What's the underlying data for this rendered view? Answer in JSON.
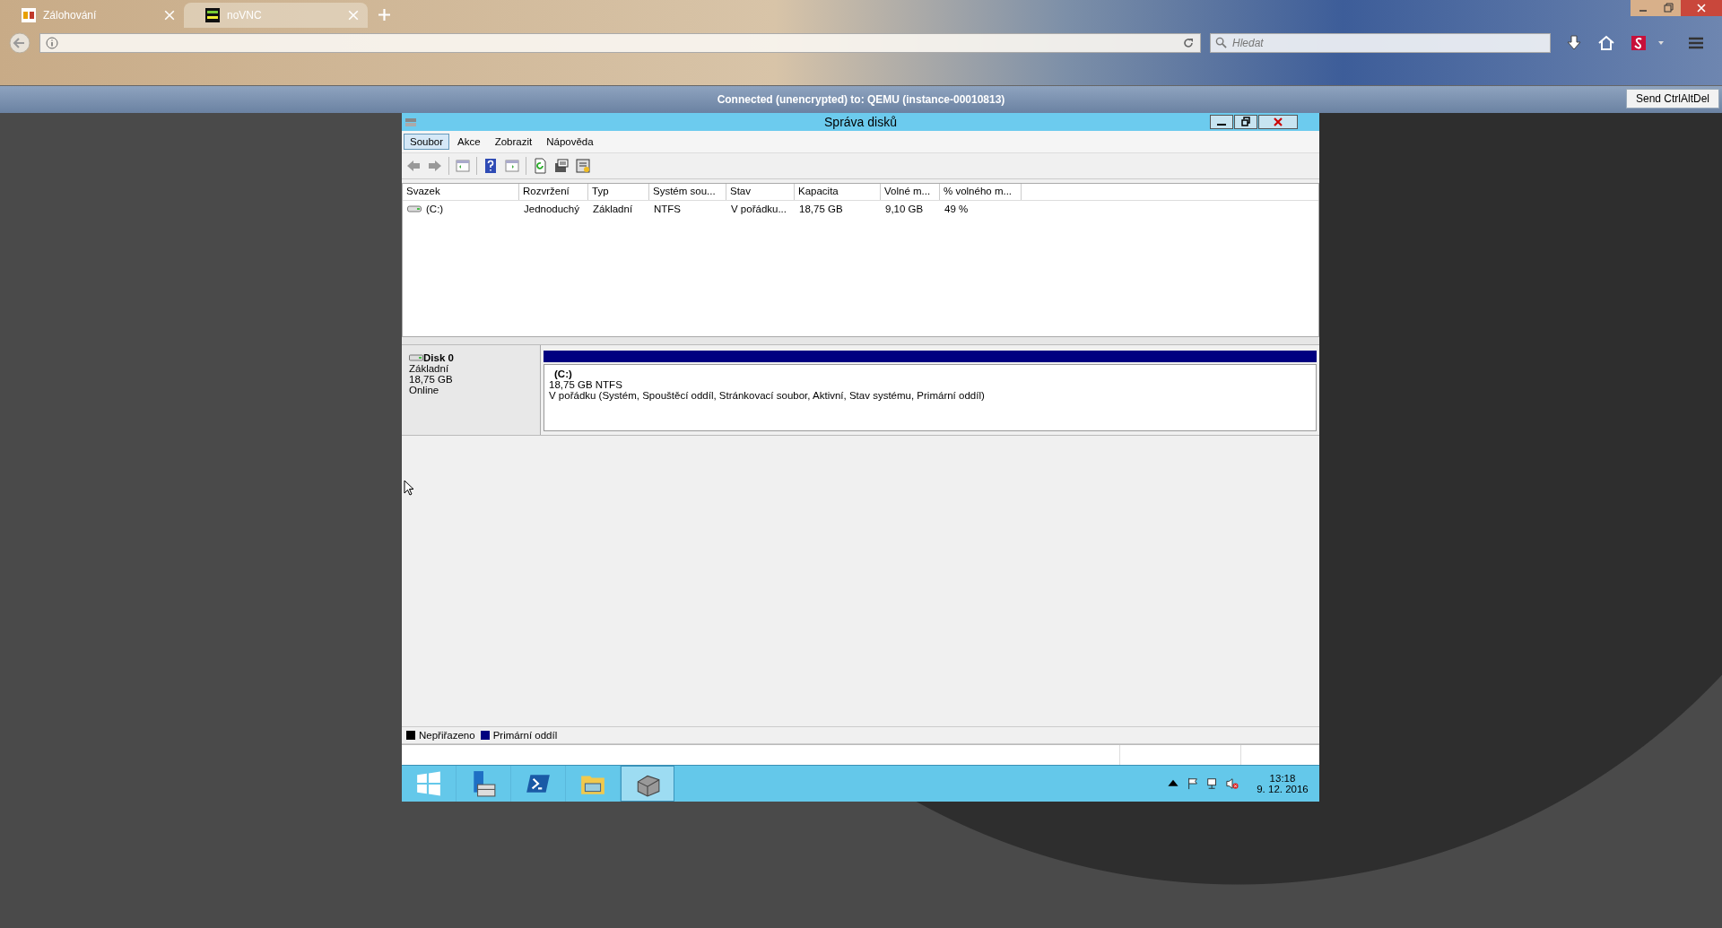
{
  "browser": {
    "tabs": [
      {
        "title": "Zálohování",
        "selected": false,
        "kind": "hc"
      },
      {
        "title": "noVNC",
        "selected": true,
        "kind": "vnc"
      }
    ],
    "search": {
      "placeholder": "Hledat"
    }
  },
  "vnc": {
    "status": "Connected (unencrypted) to: QEMU (instance-00010813)",
    "button": "Send CtrlAltDel"
  },
  "window": {
    "title": "Správa disků"
  },
  "menu": [
    {
      "label": "Soubor",
      "selected": true
    },
    {
      "label": "Akce",
      "selected": false
    },
    {
      "label": "Zobrazit",
      "selected": false
    },
    {
      "label": "Nápověda",
      "selected": false
    }
  ],
  "table": {
    "columns": [
      "Svazek",
      "Rozvržení",
      "Typ",
      "Systém sou...",
      "Stav",
      "Kapacita",
      "Volné m...",
      "% volného m..."
    ],
    "rows": [
      [
        "(C:)",
        "Jednoduchý",
        "Základní",
        "NTFS",
        "V pořádku...",
        "18,75 GB",
        "9,10 GB",
        "49 %"
      ]
    ]
  },
  "disk": {
    "name": "Disk 0",
    "type": "Základní",
    "size": "18,75 GB",
    "status": "Online",
    "partition": {
      "label": "(C:)",
      "size_fs": "18,75 GB NTFS",
      "status": "V pořádku (Systém, Spouštěcí oddíl, Stránkovací soubor, Aktivní, Stav systému, Primární oddíl)",
      "color": "#000080"
    }
  },
  "legend": [
    {
      "label": "Nepřiřazeno",
      "color": "#000000"
    },
    {
      "label": "Primární oddíl",
      "color": "#000080"
    }
  ],
  "taskbar": {
    "items": [
      {
        "kind": "start",
        "selected": false
      },
      {
        "kind": "server",
        "selected": false
      },
      {
        "kind": "powershell",
        "selected": false
      },
      {
        "kind": "explorer",
        "selected": false
      },
      {
        "kind": "disk",
        "selected": true
      }
    ],
    "time": "13:18",
    "date": "9. 12. 2016"
  }
}
